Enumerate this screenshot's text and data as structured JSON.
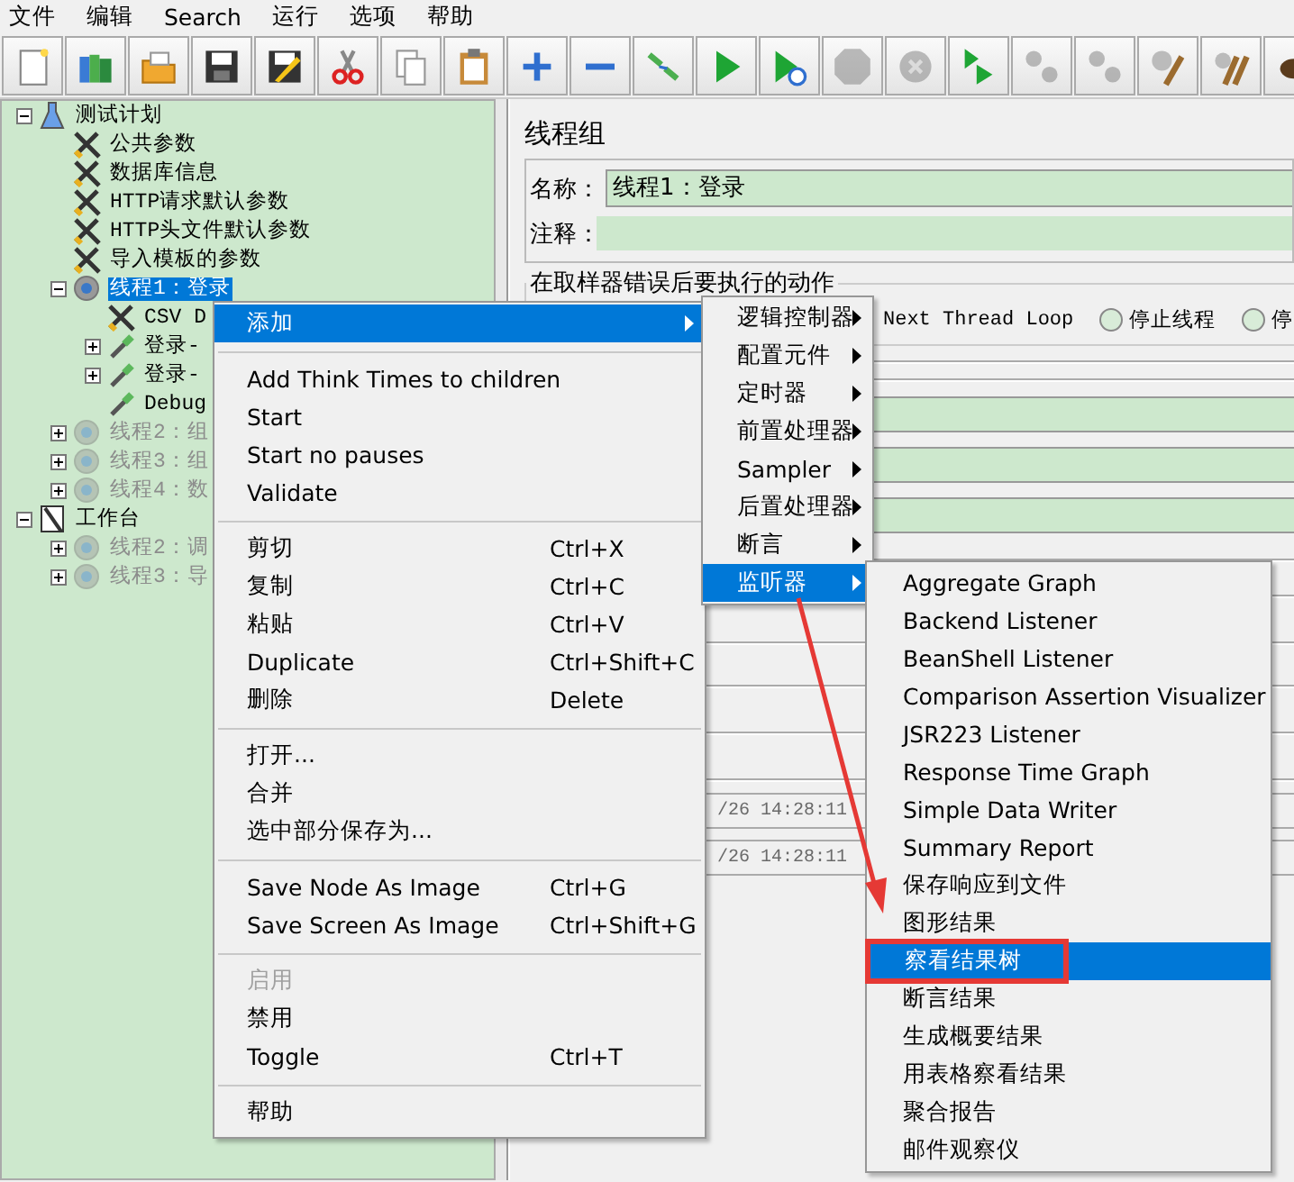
{
  "menu_bar": [
    "文件",
    "编辑",
    "Search",
    "运行",
    "选项",
    "帮助"
  ],
  "toolbar": [
    {
      "disabled": false
    },
    {
      "disabled": false
    },
    {
      "disabled": false
    },
    {
      "disabled": false
    },
    {
      "disabled": false
    },
    {
      "disabled": false
    },
    {
      "disabled": false
    },
    {
      "disabled": false
    },
    {
      "disabled": false
    },
    {
      "disabled": false
    },
    {
      "disabled": false
    },
    {
      "disabled": false
    },
    {
      "disabled": false
    },
    {
      "disabled": true
    },
    {
      "disabled": true
    },
    {
      "disabled": false
    },
    {
      "disabled": true
    },
    {
      "disabled": true
    },
    {
      "disabled": false
    },
    {
      "disabled": false
    },
    {
      "disabled": false
    }
  ],
  "tree": [
    {
      "label": "测试计划",
      "kind": "plan",
      "expanded": true,
      "selected": false,
      "disabled": false,
      "children": [
        {
          "label": "公共参数",
          "kind": "config",
          "selected": false,
          "disabled": false
        },
        {
          "label": "数据库信息",
          "kind": "config",
          "selected": false,
          "disabled": false
        },
        {
          "label": "HTTP请求默认参数",
          "kind": "config",
          "selected": false,
          "disabled": false
        },
        {
          "label": "HTTP头文件默认参数",
          "kind": "config",
          "selected": false,
          "disabled": false
        },
        {
          "label": "导入模板的参数",
          "kind": "config",
          "selected": false,
          "disabled": false
        },
        {
          "label": "线程1：登录",
          "kind": "thread",
          "expanded": true,
          "selected": true,
          "disabled": false,
          "children": [
            {
              "label": "CSV D",
              "kind": "config",
              "selected": false,
              "disabled": false
            },
            {
              "label": "登录-",
              "kind": "sampler",
              "expanded": false,
              "selected": false,
              "disabled": false
            },
            {
              "label": "登录-",
              "kind": "sampler",
              "expanded": false,
              "selected": false,
              "disabled": false
            },
            {
              "label": "Debug",
              "kind": "sampler",
              "selected": false,
              "disabled": false
            }
          ]
        },
        {
          "label": "线程2：组",
          "kind": "thread",
          "expanded": false,
          "selected": false,
          "disabled": true
        },
        {
          "label": "线程3：组",
          "kind": "thread",
          "expanded": false,
          "selected": false,
          "disabled": true
        },
        {
          "label": "线程4：数",
          "kind": "thread",
          "expanded": false,
          "selected": false,
          "disabled": true
        }
      ]
    },
    {
      "label": "工作台",
      "kind": "workbench",
      "expanded": true,
      "selected": false,
      "disabled": false,
      "children": [
        {
          "label": "线程2：调",
          "kind": "thread",
          "expanded": false,
          "selected": false,
          "disabled": true
        },
        {
          "label": "线程3：导",
          "kind": "thread",
          "expanded": false,
          "selected": false,
          "disabled": true
        }
      ]
    }
  ],
  "panel": {
    "title": "线程组",
    "name_label": "名称：",
    "name_value": "线程1：登录",
    "comment_label": "注释：",
    "error_action": {
      "legend": "在取样器错误后要执行的动作",
      "options": [
        {
          "label": "Next Thread Loop"
        },
        {
          "label": "停止线程",
          "selected": false
        },
        {
          "label": "停",
          "selected": false
        }
      ]
    },
    "timestamps": [
      "/26 14:28:11",
      "/26 14:28:11"
    ]
  },
  "context_menu": {
    "items": [
      {
        "kind": "submenu",
        "label": "添加",
        "selected": true,
        "disabled": false
      },
      {
        "kind": "separator"
      },
      {
        "kind": "item",
        "label": "Add Think Times to children",
        "selected": false,
        "disabled": false
      },
      {
        "kind": "item",
        "label": "Start",
        "selected": false,
        "disabled": false
      },
      {
        "kind": "item",
        "label": "Start no pauses",
        "selected": false,
        "disabled": false
      },
      {
        "kind": "item",
        "label": "Validate",
        "selected": false,
        "disabled": false
      },
      {
        "kind": "separator"
      },
      {
        "kind": "item",
        "label": "剪切",
        "shortcut": "Ctrl+X",
        "selected": false,
        "disabled": false
      },
      {
        "kind": "item",
        "label": "复制",
        "shortcut": "Ctrl+C",
        "selected": false,
        "disabled": false
      },
      {
        "kind": "item",
        "label": "粘贴",
        "shortcut": "Ctrl+V",
        "selected": false,
        "disabled": false
      },
      {
        "kind": "item",
        "label": "Duplicate",
        "shortcut": "Ctrl+Shift+C",
        "selected": false,
        "disabled": false
      },
      {
        "kind": "item",
        "label": "删除",
        "shortcut": "Delete",
        "selected": false,
        "disabled": false
      },
      {
        "kind": "separator"
      },
      {
        "kind": "item",
        "label": "打开...",
        "selected": false,
        "disabled": false
      },
      {
        "kind": "item",
        "label": "合并",
        "selected": false,
        "disabled": false
      },
      {
        "kind": "item",
        "label": "选中部分保存为...",
        "selected": false,
        "disabled": false
      },
      {
        "kind": "separator"
      },
      {
        "kind": "item",
        "label": "Save Node As Image",
        "shortcut": "Ctrl+G",
        "selected": false,
        "disabled": false
      },
      {
        "kind": "item",
        "label": "Save Screen As Image",
        "shortcut": "Ctrl+Shift+G",
        "selected": false,
        "disabled": false
      },
      {
        "kind": "separator"
      },
      {
        "kind": "item",
        "label": "启用",
        "selected": false,
        "disabled": true
      },
      {
        "kind": "item",
        "label": "禁用",
        "selected": false,
        "disabled": false
      },
      {
        "kind": "item",
        "label": "Toggle",
        "shortcut": "Ctrl+T",
        "selected": false,
        "disabled": false
      },
      {
        "kind": "separator"
      },
      {
        "kind": "item",
        "label": "帮助",
        "selected": false,
        "disabled": false
      }
    ]
  },
  "add_submenu": {
    "items": [
      {
        "label": "逻辑控制器",
        "selected": false
      },
      {
        "label": "配置元件",
        "selected": false
      },
      {
        "label": "定时器",
        "selected": false
      },
      {
        "label": "前置处理器",
        "selected": false
      },
      {
        "label": "Sampler",
        "selected": false
      },
      {
        "label": "后置处理器",
        "selected": false
      },
      {
        "label": "断言",
        "selected": false
      },
      {
        "label": "监听器",
        "selected": true
      }
    ]
  },
  "listener_submenu": {
    "items": [
      {
        "label": "Aggregate Graph",
        "selected": false
      },
      {
        "label": "Backend Listener",
        "selected": false
      },
      {
        "label": "BeanShell Listener",
        "selected": false
      },
      {
        "label": "Comparison Assertion Visualizer",
        "selected": false
      },
      {
        "label": "JSR223 Listener",
        "selected": false
      },
      {
        "label": "Response Time Graph",
        "selected": false
      },
      {
        "label": "Simple Data Writer",
        "selected": false
      },
      {
        "label": "Summary Report",
        "selected": false
      },
      {
        "label": "保存响应到文件",
        "selected": false
      },
      {
        "label": "图形结果",
        "selected": false
      },
      {
        "label": "察看结果树",
        "selected": true
      },
      {
        "label": "断言结果",
        "selected": false
      },
      {
        "label": "生成概要结果",
        "selected": false
      },
      {
        "label": "用表格察看结果",
        "selected": false
      },
      {
        "label": "聚合报告",
        "selected": false
      },
      {
        "label": "邮件观察仪",
        "selected": false
      }
    ]
  },
  "annotations": {
    "arrow": true,
    "frame": true
  }
}
